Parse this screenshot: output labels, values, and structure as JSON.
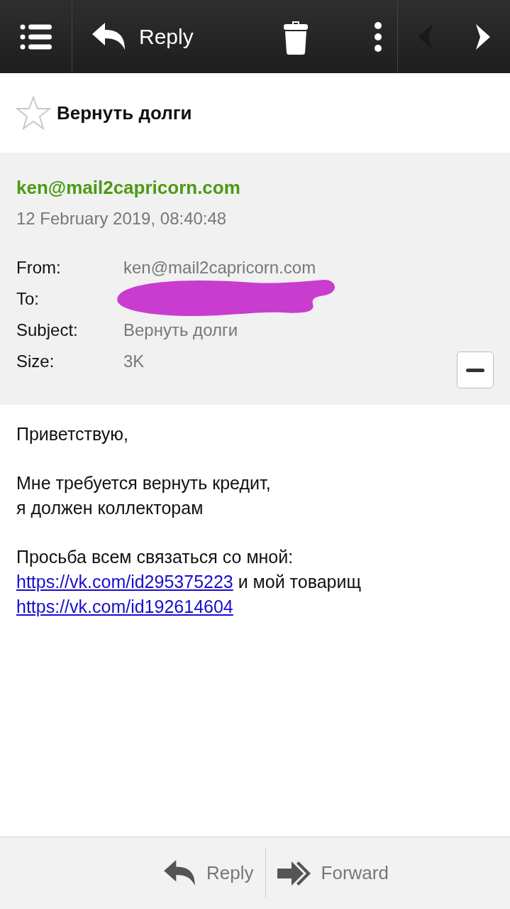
{
  "toolbar": {
    "reply_label": "Reply",
    "prev_disabled": true,
    "next_disabled": false
  },
  "message": {
    "subject": "Вернуть долги",
    "starred": false
  },
  "header": {
    "sender": "ken@mail2capricorn.com",
    "date": "12 February 2019, 08:40:48",
    "redacted": true,
    "fields": [
      {
        "label": "From:",
        "value": "ken@mail2capricorn.com"
      },
      {
        "label": "To:"
      },
      {
        "label": "Subject:",
        "value": "Вернуть долги"
      },
      {
        "label": "Size:",
        "value": "3K"
      }
    ],
    "expanded": true
  },
  "body": [
    {
      "lines": [
        [
          {
            "text": "Приветствую,",
            "link": false
          }
        ]
      ]
    },
    {
      "lines": [
        [
          {
            "text": "Мне требуется вернуть кредит,",
            "link": false
          }
        ],
        [
          {
            "text": "я должен коллекторам",
            "link": false
          }
        ]
      ]
    },
    {
      "lines": [
        [
          {
            "text": "Просьба всем связаться со мной:",
            "link": false
          }
        ],
        [
          {
            "text": "https://vk.com/id295375223",
            "link": true
          },
          {
            "text": " и мой товарищ",
            "link": false
          }
        ],
        [
          {
            "text": "https://vk.com/id192614604",
            "link": true
          }
        ]
      ]
    }
  ],
  "footer": {
    "reply_label": "Reply",
    "forward_label": "Forward"
  }
}
